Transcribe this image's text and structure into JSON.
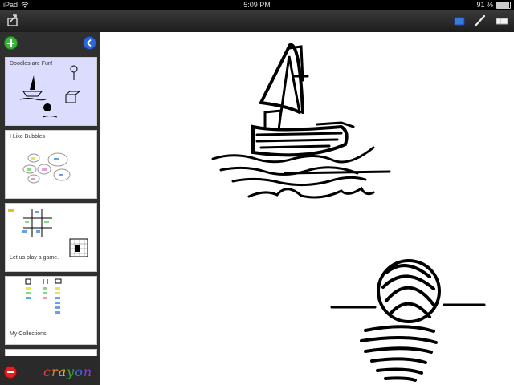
{
  "status": {
    "device": "iPad",
    "time": "5:09 PM",
    "battery": "91 %",
    "battery_level": 91
  },
  "sidebar": {
    "pages": [
      {
        "caption": "Doodles are Fun!"
      },
      {
        "caption": "I Like Bubbles"
      },
      {
        "caption": "Let us play a game."
      },
      {
        "caption": "My Collections"
      }
    ],
    "logo": {
      "letters": [
        "c",
        "r",
        "a",
        "y",
        "o",
        "n"
      ],
      "colors": [
        "#e04040",
        "#e08a20",
        "#d6c020",
        "#3aaa3a",
        "#3a6ed8",
        "#8a3ad8"
      ]
    }
  },
  "colors": {
    "toolbar_blue": "#3a7ae0",
    "selected_thumb": "#dcdcff"
  }
}
